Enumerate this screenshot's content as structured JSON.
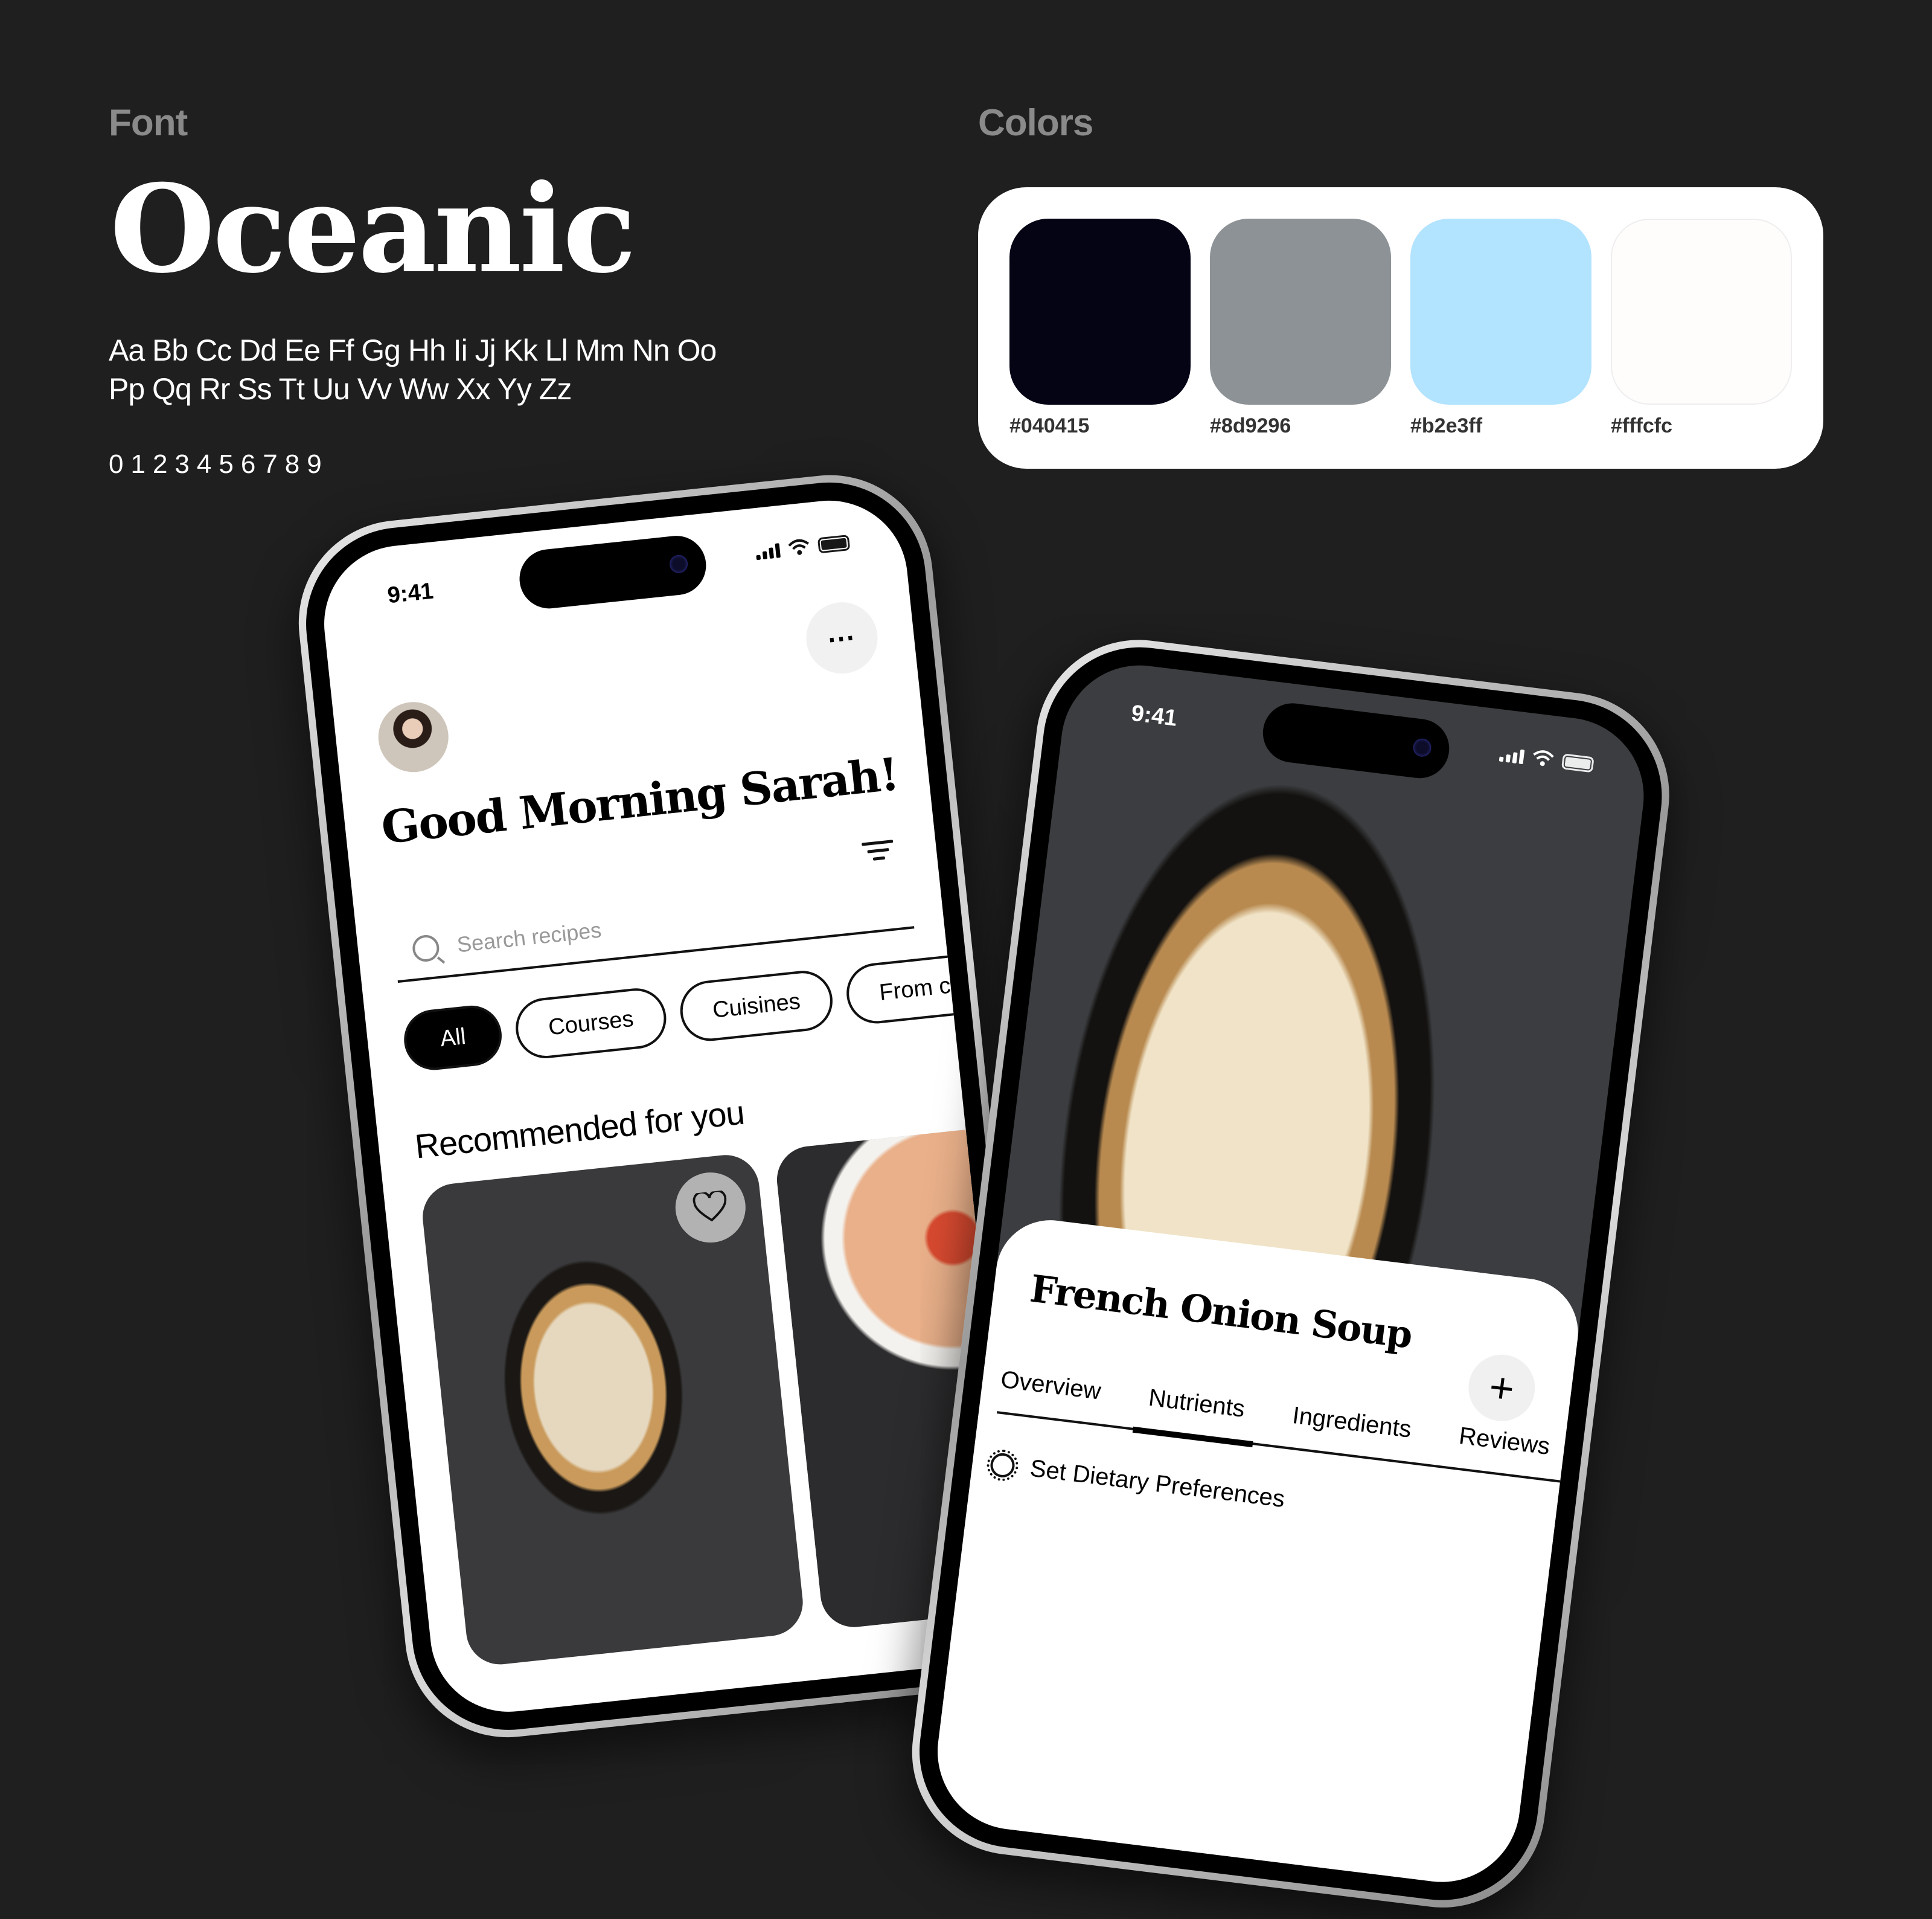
{
  "font_section": {
    "label": "Font",
    "font_name": "Oceanic",
    "alphabet_line1": "Aa Bb Cc Dd Ee Ff Gg Hh Ii Jj Kk Ll Mm Nn Oo",
    "alphabet_line2": "Pp Qq Rr Ss Tt Uu Vv Ww Xx Yy Zz",
    "digits": "0123456789"
  },
  "colors_section": {
    "label": "Colors",
    "swatches": [
      {
        "hex": "#040415",
        "label": "#040415"
      },
      {
        "hex": "#8d9296",
        "label": "#8d9296"
      },
      {
        "hex": "#b2e3ff",
        "label": "#b2e3ff"
      },
      {
        "hex": "#fffcfc",
        "label": "#fffcfc"
      }
    ]
  },
  "phone_home": {
    "status_time": "9:41",
    "more_icon": "⋯",
    "greeting": "Good Morning Sarah!",
    "search_placeholder": "Search recipes",
    "chips": [
      "All",
      "Courses",
      "Cuisines",
      "From chefs"
    ],
    "active_chip": "All",
    "section_title": "Recommended for you",
    "cards": [
      {
        "name": "french-onion-soup",
        "favorite_icon": "heart-outline"
      },
      {
        "name": "shrimp-rice-bowl"
      }
    ]
  },
  "phone_detail": {
    "status_time": "9:41",
    "dish_title": "French Onion Soup",
    "add_icon": "+",
    "tabs": [
      "Overview",
      "Nutrients",
      "Ingredients",
      "Reviews"
    ],
    "active_tab": "Nutrients",
    "preference_label": "Set Dietary Preferences"
  }
}
